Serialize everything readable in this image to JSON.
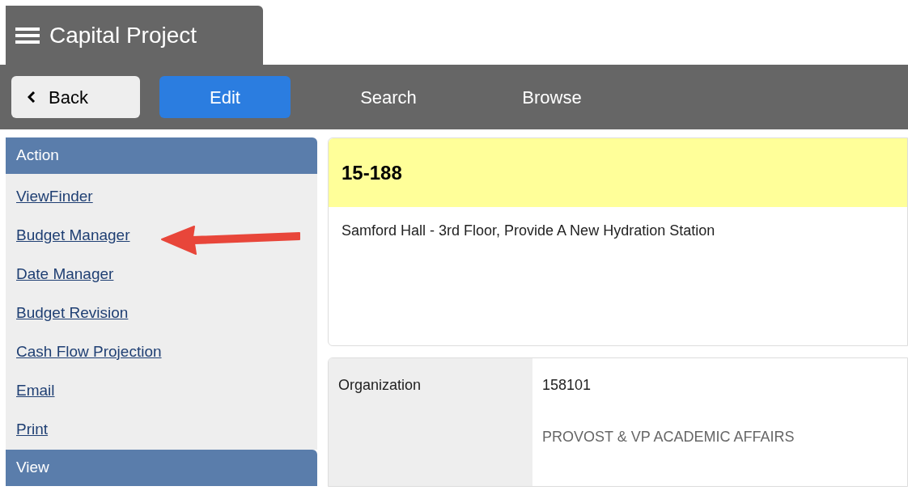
{
  "app": {
    "title": "Capital Project"
  },
  "back_button": {
    "label": "Back"
  },
  "tabs": [
    {
      "label": "Edit",
      "selected": true
    },
    {
      "label": "Search",
      "selected": false
    },
    {
      "label": "Browse",
      "selected": false
    }
  ],
  "sidebar": {
    "sections": [
      {
        "title": "Action",
        "links": [
          "ViewFinder",
          "Budget Manager",
          "Date Manager",
          "Budget Revision",
          "Cash Flow Projection",
          "Email",
          "Print"
        ]
      },
      {
        "title": "View"
      }
    ]
  },
  "record": {
    "id": "15-188",
    "description": "Samford Hall - 3rd Floor, Provide A New Hydration Station"
  },
  "fields": [
    {
      "label": "Organization",
      "value": "158101",
      "detail": "PROVOST & VP ACADEMIC AFFAIRS"
    }
  ]
}
